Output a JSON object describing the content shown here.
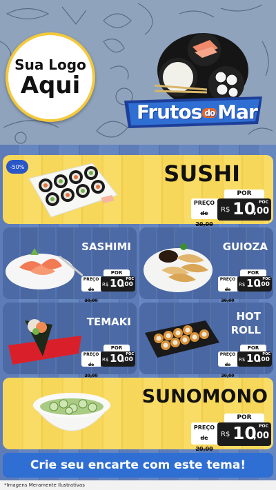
{
  "logo": {
    "line1": "Sua Logo",
    "line2": "Aqui"
  },
  "brand": {
    "part1": "Frutos",
    "part2": "do",
    "part3": "Mar"
  },
  "discount_badge": "-50%",
  "price_labels": {
    "por": "POR",
    "preco": "PREÇO",
    "currency": "R$",
    "unit": "POC"
  },
  "items": {
    "sushi": {
      "name": "SUSHI",
      "old_price": "de 20,00",
      "price_int": "10",
      "price_dec": ",00"
    },
    "sashimi": {
      "name": "SASHIMI",
      "old_price": "de 20,00",
      "price_int": "10",
      "price_dec": ",00"
    },
    "guioza": {
      "name": "GUIOZA",
      "old_price": "de 20,00",
      "price_int": "10",
      "price_dec": ",00"
    },
    "temaki": {
      "name": "TEMAKI",
      "old_price": "de 20,00",
      "price_int": "10",
      "price_dec": ",00"
    },
    "hotroll": {
      "name_line1": "HOT",
      "name_line2": "ROLL",
      "old_price": "de 20,00",
      "price_int": "10",
      "price_dec": ",00"
    },
    "sunomono": {
      "name": "SUNOMONO",
      "old_price": "de 20,00",
      "price_int": "10",
      "price_dec": ",00"
    }
  },
  "cta": "Crie seu encarte com este tema!",
  "footer_note": "*Imagens Meramente Ilustrativas",
  "colors": {
    "yellow": "#f7d75a",
    "blue": "#5474b1",
    "accent": "#2f6fd3",
    "dark": "#1b1b1b"
  }
}
